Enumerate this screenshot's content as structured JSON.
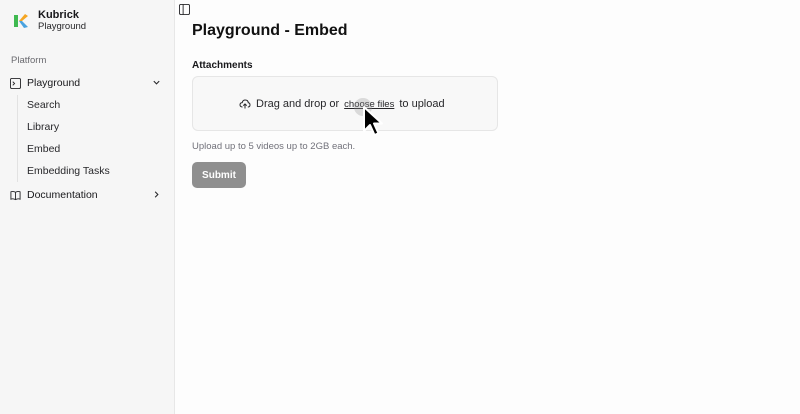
{
  "app": {
    "name": "Kubrick",
    "subtitle": "Playground"
  },
  "sidebar": {
    "group_label": "Platform",
    "items": [
      {
        "label": "Playground",
        "icon": "terminal-icon",
        "expanded": true,
        "children": [
          {
            "label": "Search"
          },
          {
            "label": "Library"
          },
          {
            "label": "Embed"
          },
          {
            "label": "Embedding Tasks"
          }
        ]
      },
      {
        "label": "Documentation",
        "icon": "book-icon",
        "expanded": false
      }
    ]
  },
  "main": {
    "title": "Playground - Embed",
    "attachments_label": "Attachments",
    "dropzone": {
      "prefix": "Drag and drop or",
      "link": "choose files",
      "suffix": "to upload"
    },
    "hint": "Upload up to 5 videos up to 2GB each.",
    "submit_label": "Submit"
  },
  "colors": {
    "sidebar_bg": "#f6f6f6",
    "submit_bg": "#8f8f8f",
    "logo_orange": "#f5a623",
    "logo_green": "#3fb950"
  }
}
